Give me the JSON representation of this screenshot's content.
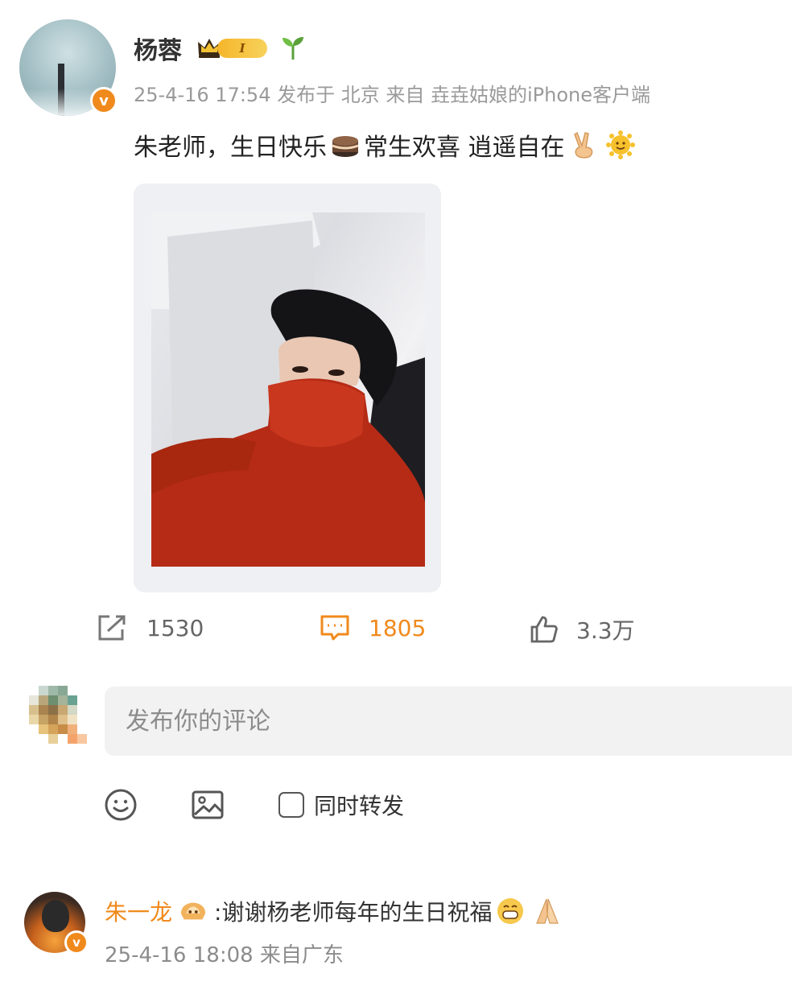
{
  "post": {
    "author": "杨蓉",
    "level_badge": "I",
    "meta": "25-4-16 17:54 发布于 北京 来自 垚垚姑娘的iPhone客户端",
    "text_part1": "朱老师，生日快乐",
    "text_part2": " 常生欢喜 逍遥自在 ",
    "emoji_names": [
      "cake-icon",
      "victory-hand-icon",
      "sun-face-icon"
    ]
  },
  "actions": {
    "repost_count": "1530",
    "comment_count": "1805",
    "like_count": "3.3万"
  },
  "composer": {
    "placeholder": "发布你的评论",
    "repost_option_label": "同时转发"
  },
  "reply": {
    "name": "朱一龙",
    "text": ":谢谢杨老师每年的生日祝福",
    "meta": "25-4-16 18:08 来自广东"
  },
  "colors": {
    "accent_orange": "#f08a1c",
    "muted_text": "#9a9a9a",
    "input_bg": "#f2f2f2"
  }
}
